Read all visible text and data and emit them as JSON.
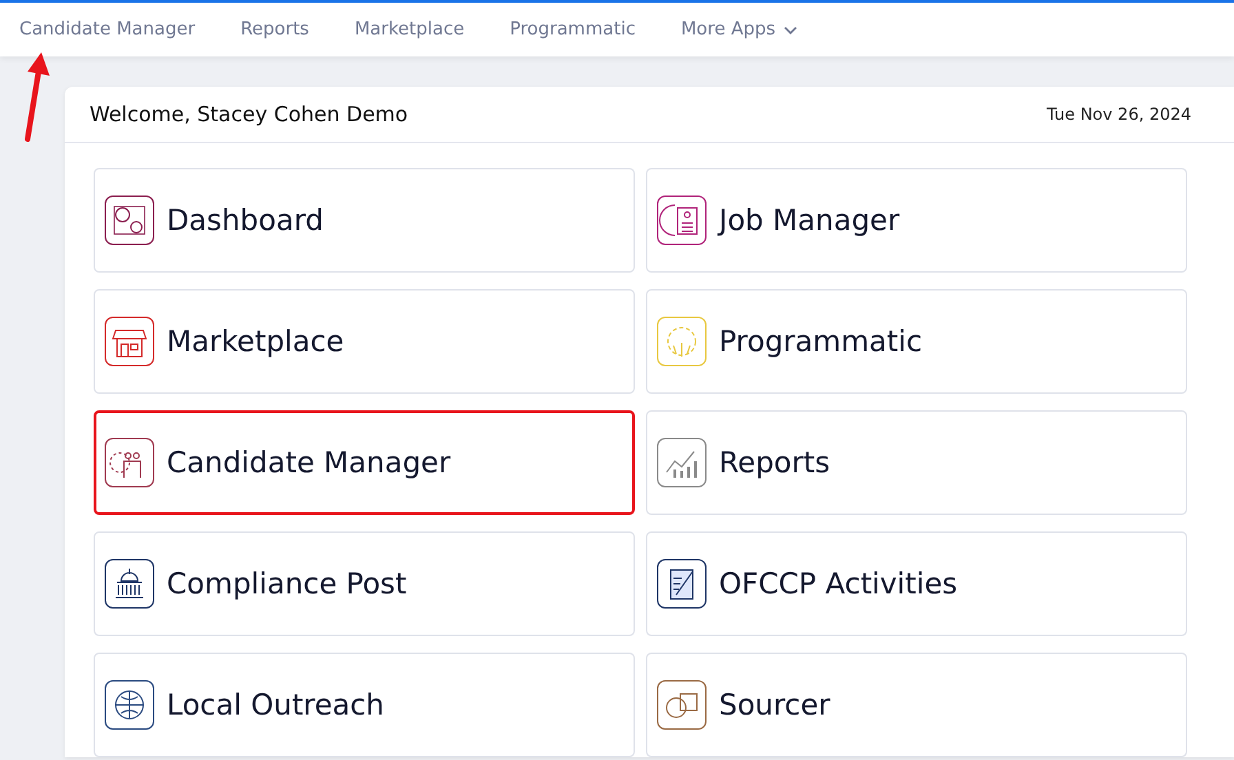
{
  "nav": {
    "items": [
      {
        "label": "Candidate Manager"
      },
      {
        "label": "Reports"
      },
      {
        "label": "Marketplace"
      },
      {
        "label": "Programmatic"
      },
      {
        "label": "More Apps",
        "dropdown": true
      }
    ]
  },
  "welcome": {
    "title": "Welcome, Stacey Cohen Demo",
    "date": "Tue Nov 26, 2024"
  },
  "tiles": [
    {
      "label": "Dashboard",
      "color": "#8b1e4f",
      "highlighted": false
    },
    {
      "label": "Job Manager",
      "color": "#b0237a",
      "highlighted": false
    },
    {
      "label": "Marketplace",
      "color": "#d42a2a",
      "highlighted": false
    },
    {
      "label": "Programmatic",
      "color": "#e8c840",
      "highlighted": false
    },
    {
      "label": "Candidate Manager",
      "color": "#a03a50",
      "highlighted": true
    },
    {
      "label": "Reports",
      "color": "#8a8a8a",
      "highlighted": false
    },
    {
      "label": "Compliance Post",
      "color": "#1e3566",
      "highlighted": false
    },
    {
      "label": "OFCCP Activities",
      "color": "#1e3566",
      "highlighted": false
    },
    {
      "label": "Local Outreach",
      "color": "#2a4a80",
      "highlighted": false
    },
    {
      "label": "Sourcer",
      "color": "#9a6a44",
      "highlighted": false
    }
  ],
  "annotation": {
    "arrow": true
  }
}
